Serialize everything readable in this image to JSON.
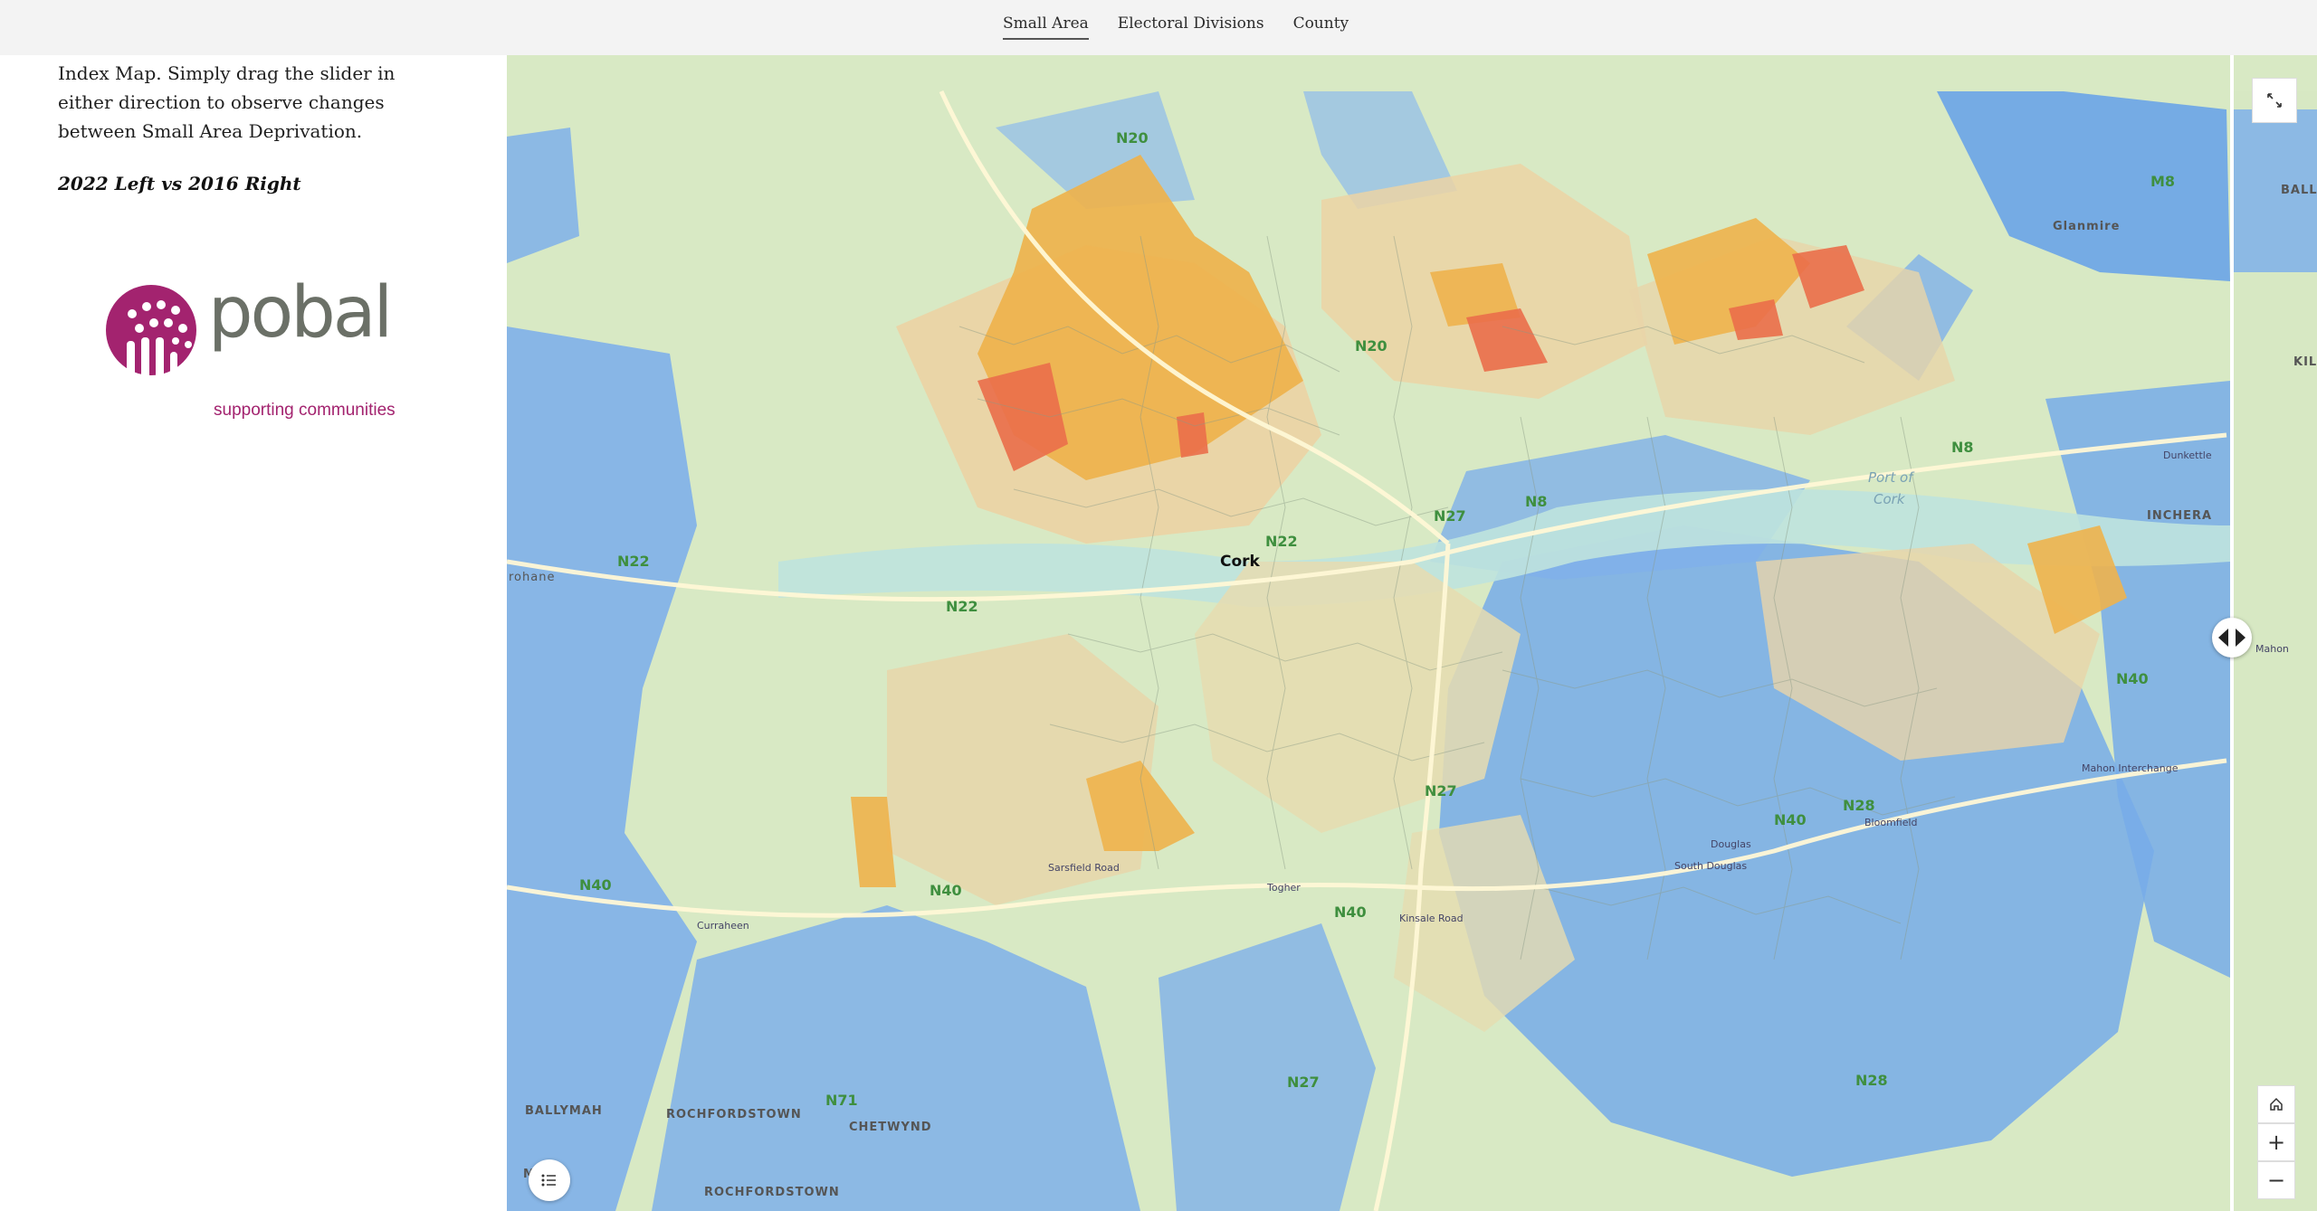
{
  "nav": {
    "tabs": [
      {
        "label": "Small Area",
        "active": true
      },
      {
        "label": "Electoral Divisions",
        "active": false
      },
      {
        "label": "County",
        "active": false
      }
    ]
  },
  "sidebar": {
    "intro": "Index Map. Simply drag the slider in either direction to observe changes between Small Area Deprivation.",
    "comparison": "2022 Left vs 2016 Right",
    "logo": {
      "word": "pobal",
      "tagline": "supporting communities",
      "color_magenta": "#a3236f",
      "color_grey": "#6b7067"
    }
  },
  "map": {
    "city": "Cork",
    "towns": [
      "Glanmire",
      "BALLYMAH",
      "ROCHFORDSTOWN",
      "CHETWYND",
      "MAH",
      "ROCHFORDSTOWN",
      "INCHERA",
      "BALLI",
      "KIL",
      "rohane"
    ],
    "water": [
      "Port of",
      "Cork"
    ],
    "roads": [
      "N20",
      "N20",
      "N8",
      "N8",
      "N22",
      "N22",
      "N22",
      "N27",
      "N27",
      "N27",
      "N40",
      "N40",
      "N40",
      "N40",
      "N40",
      "N28",
      "N28",
      "N71",
      "M8"
    ],
    "places": [
      "Sarsfield Road",
      "Togher",
      "Kinsale Road",
      "Curraheen",
      "Douglas",
      "South Douglas",
      "Bloomfield",
      "Mahon Interchange",
      "Dunkettle",
      "Mahon"
    ],
    "colors": {
      "affluent": "#6aa4e8",
      "marginal_above": "#c9d9a3",
      "marginal_below": "#ecd3a4",
      "disadvantaged": "#eeb24c",
      "very_disadvantaged": "#ea6e4a"
    },
    "controls": {
      "fullscreen": "fullscreen-icon",
      "home": "home-icon",
      "zoom_in": "+",
      "zoom_out": "−",
      "legend": "legend-icon"
    }
  }
}
